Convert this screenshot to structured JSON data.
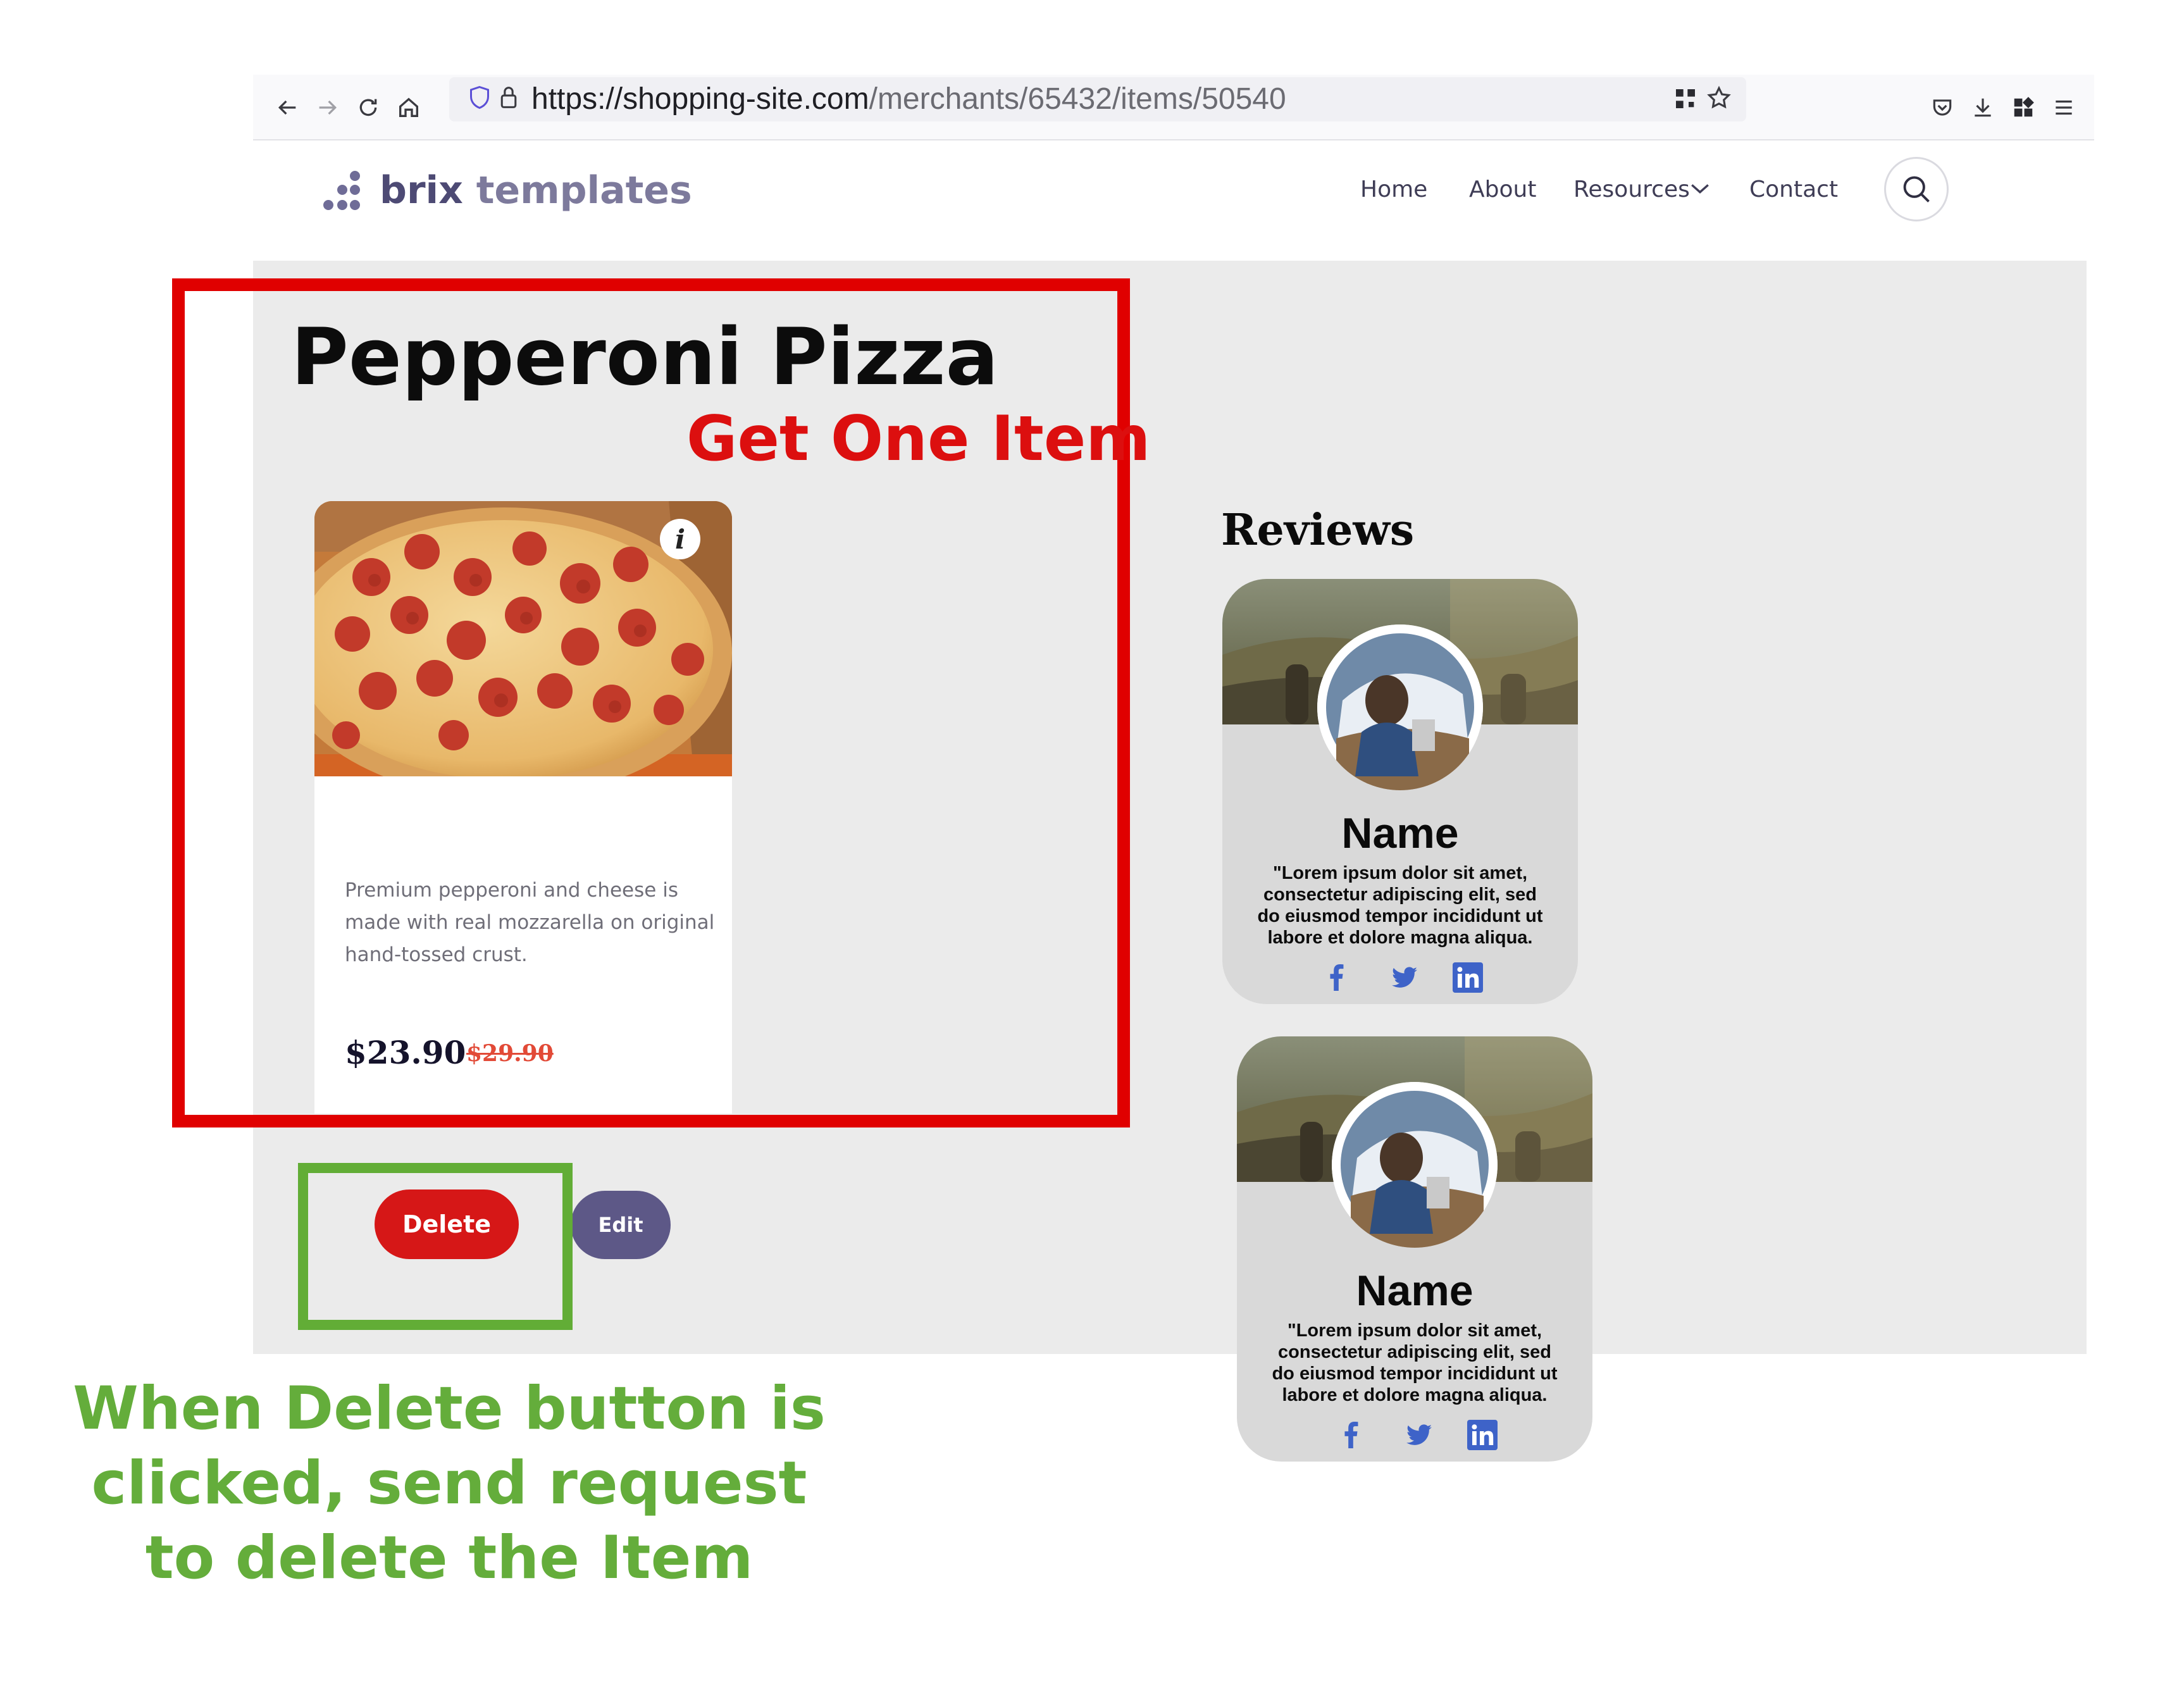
{
  "browser": {
    "url_host": "https://shopping-site.com",
    "url_path": "/merchants/65432/items/50540"
  },
  "site": {
    "logo_primary": "brix",
    "logo_secondary": "templates",
    "nav": [
      "Home",
      "About",
      "Resources",
      "Contact"
    ]
  },
  "item": {
    "title": "Pepperoni Pizza",
    "description": "Premium pepperoni and cheese is made with real mozzarella on original hand-tossed crust.",
    "price": "$23.90",
    "old_price": "$29.90"
  },
  "actions": {
    "delete_label": "Delete",
    "edit_label": "Edit"
  },
  "reviews": {
    "heading": "Reviews",
    "items": [
      {
        "name": "Name",
        "text": "\"Lorem ipsum dolor sit amet, consectetur adipiscing elit, sed do eiusmod tempor incididunt ut labore et dolore magna aliqua."
      },
      {
        "name": "Name",
        "text": "\"Lorem ipsum dolor sit amet, consectetur adipiscing elit, sed do eiusmod tempor incididunt ut labore et dolore magna aliqua."
      }
    ]
  },
  "annotations": {
    "get_one": "Get One Item",
    "delete_note": "When Delete button is clicked, send request to delete the Item"
  },
  "colors": {
    "annotation_red": "#e00000",
    "annotation_green": "#62ad36",
    "delete_button": "#d61717",
    "edit_button": "#5d5887",
    "brand": "#4d4a74"
  }
}
